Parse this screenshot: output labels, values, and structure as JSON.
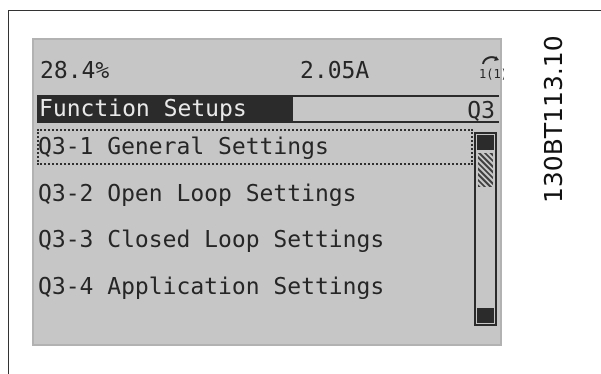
{
  "status": {
    "left_value": "28.4%",
    "mid_value": "2.05A",
    "icon": "parameter-setup-icon",
    "icon_text": "1(1)"
  },
  "header": {
    "title": "Function Setups",
    "code": "Q3"
  },
  "menu": {
    "items": [
      {
        "label": "Q3-1 General Settings",
        "selected": true
      },
      {
        "label": "Q3-2 Open Loop Settings",
        "selected": false
      },
      {
        "label": "Q3-3 Closed Loop Settings",
        "selected": false
      },
      {
        "label": "Q3-4 Application Settings",
        "selected": false
      }
    ]
  },
  "figure": {
    "reference_code": "130BT113.10"
  },
  "colors": {
    "lcd_background": "#c6c6c6",
    "lcd_border": "#b2b2b2",
    "text": "#262626",
    "header_background": "#2b2b2b"
  }
}
